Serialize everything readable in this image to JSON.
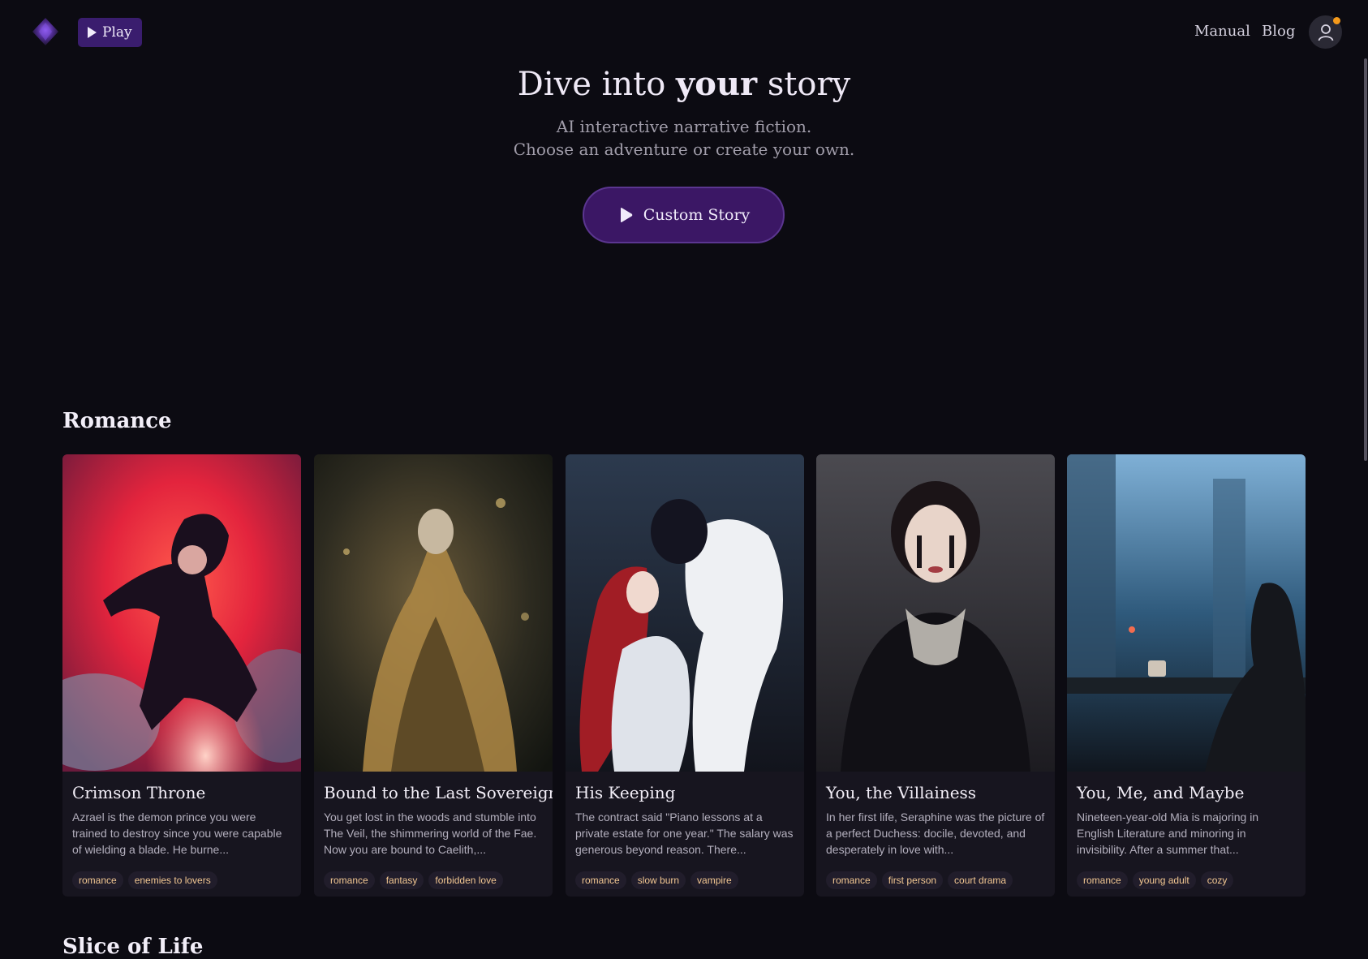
{
  "header": {
    "play_label": "Play",
    "nav": [
      {
        "label": "Manual"
      },
      {
        "label": "Blog"
      }
    ]
  },
  "hero": {
    "title_pre": "Dive into ",
    "title_bold": "your",
    "title_post": " story",
    "subtitle_line1": "AI interactive narrative fiction.",
    "subtitle_line2": "Choose an adventure or create your own.",
    "cta_label": "Custom Story"
  },
  "sections": [
    {
      "title": "Romance",
      "cards": [
        {
          "title": "Crimson Throne",
          "description": "Azrael is the demon prince you were trained to destroy since you were capable of wielding a blade. He burne...",
          "tags": [
            "romance",
            "enemies to lovers"
          ]
        },
        {
          "title": "Bound to the Last Sovereign",
          "description": "You get lost in the woods and stumble into The Veil, the shimmering world of the Fae. Now you are bound to Caelith,...",
          "tags": [
            "romance",
            "fantasy",
            "forbidden love"
          ]
        },
        {
          "title": "His Keeping",
          "description": "The contract said \"Piano lessons at a private estate for one year.\" The salary was generous beyond reason. There...",
          "tags": [
            "romance",
            "slow burn",
            "vampire"
          ]
        },
        {
          "title": "You, the Villainess",
          "description": "In her first life, Seraphine was the picture of a perfect Duchess: docile, devoted, and desperately in love with...",
          "tags": [
            "romance",
            "first person",
            "court drama"
          ]
        },
        {
          "title": "You, Me, and Maybe",
          "description": "Nineteen-year-old Mia is majoring in English Literature and minoring in invisibility. After a summer that...",
          "tags": [
            "romance",
            "young adult",
            "cozy"
          ]
        }
      ]
    },
    {
      "title": "Slice of Life"
    }
  ],
  "colors": {
    "background": "#0c0b12",
    "accent": "#3b1765",
    "tag_text": "#f2c792",
    "notification": "#f59a1b"
  }
}
